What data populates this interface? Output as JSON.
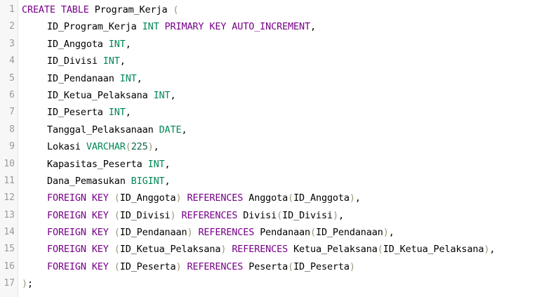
{
  "editor": {
    "lines": [
      {
        "number": "1",
        "tokens": [
          {
            "t": "CREATE TABLE",
            "c": "kw"
          },
          {
            "t": " Program_Kerja ",
            "c": "id"
          },
          {
            "t": "(",
            "c": "pun"
          }
        ],
        "indent": false
      },
      {
        "number": "2",
        "tokens": [
          {
            "t": "ID_Program_Kerja ",
            "c": "id"
          },
          {
            "t": "INT",
            "c": "ty"
          },
          {
            "t": " ",
            "c": "id"
          },
          {
            "t": "PRIMARY KEY",
            "c": "kw"
          },
          {
            "t": " ",
            "c": "id"
          },
          {
            "t": "AUTO_INCREMENT",
            "c": "kw"
          },
          {
            "t": ",",
            "c": "id"
          }
        ],
        "indent": true
      },
      {
        "number": "3",
        "tokens": [
          {
            "t": "ID_Anggota ",
            "c": "id"
          },
          {
            "t": "INT",
            "c": "ty"
          },
          {
            "t": ",",
            "c": "id"
          }
        ],
        "indent": true
      },
      {
        "number": "4",
        "tokens": [
          {
            "t": "ID_Divisi ",
            "c": "id"
          },
          {
            "t": "INT",
            "c": "ty"
          },
          {
            "t": ",",
            "c": "id"
          }
        ],
        "indent": true
      },
      {
        "number": "5",
        "tokens": [
          {
            "t": "ID_Pendanaan ",
            "c": "id"
          },
          {
            "t": "INT",
            "c": "ty"
          },
          {
            "t": ",",
            "c": "id"
          }
        ],
        "indent": true
      },
      {
        "number": "6",
        "tokens": [
          {
            "t": "ID_Ketua_Pelaksana ",
            "c": "id"
          },
          {
            "t": "INT",
            "c": "ty"
          },
          {
            "t": ",",
            "c": "id"
          }
        ],
        "indent": true
      },
      {
        "number": "7",
        "tokens": [
          {
            "t": "ID_Peserta ",
            "c": "id"
          },
          {
            "t": "INT",
            "c": "ty"
          },
          {
            "t": ",",
            "c": "id"
          }
        ],
        "indent": true
      },
      {
        "number": "8",
        "tokens": [
          {
            "t": "Tanggal_Pelaksanaan ",
            "c": "id"
          },
          {
            "t": "DATE",
            "c": "ty"
          },
          {
            "t": ",",
            "c": "id"
          }
        ],
        "indent": true
      },
      {
        "number": "9",
        "tokens": [
          {
            "t": "Lokasi ",
            "c": "id"
          },
          {
            "t": "VARCHAR",
            "c": "ty"
          },
          {
            "t": "(",
            "c": "pun"
          },
          {
            "t": "225",
            "c": "num"
          },
          {
            "t": ")",
            "c": "pun"
          },
          {
            "t": ",",
            "c": "id"
          }
        ],
        "indent": true
      },
      {
        "number": "10",
        "tokens": [
          {
            "t": "Kapasitas_Peserta ",
            "c": "id"
          },
          {
            "t": "INT",
            "c": "ty"
          },
          {
            "t": ",",
            "c": "id"
          }
        ],
        "indent": true
      },
      {
        "number": "11",
        "tokens": [
          {
            "t": "Dana_Pemasukan ",
            "c": "id"
          },
          {
            "t": "BIGINT",
            "c": "ty"
          },
          {
            "t": ",",
            "c": "id"
          }
        ],
        "indent": true
      },
      {
        "number": "12",
        "tokens": [
          {
            "t": "FOREIGN KEY",
            "c": "kw"
          },
          {
            "t": " ",
            "c": "id"
          },
          {
            "t": "(",
            "c": "pun"
          },
          {
            "t": "ID_Anggota",
            "c": "id"
          },
          {
            "t": ")",
            "c": "pun"
          },
          {
            "t": " ",
            "c": "id"
          },
          {
            "t": "REFERENCES",
            "c": "kw"
          },
          {
            "t": " Anggota",
            "c": "id"
          },
          {
            "t": "(",
            "c": "pun"
          },
          {
            "t": "ID_Anggota",
            "c": "id"
          },
          {
            "t": ")",
            "c": "pun"
          },
          {
            "t": ",",
            "c": "id"
          }
        ],
        "indent": true
      },
      {
        "number": "13",
        "tokens": [
          {
            "t": "FOREIGN KEY",
            "c": "kw"
          },
          {
            "t": " ",
            "c": "id"
          },
          {
            "t": "(",
            "c": "pun"
          },
          {
            "t": "ID_Divisi",
            "c": "id"
          },
          {
            "t": ")",
            "c": "pun"
          },
          {
            "t": " ",
            "c": "id"
          },
          {
            "t": "REFERENCES",
            "c": "kw"
          },
          {
            "t": " Divisi",
            "c": "id"
          },
          {
            "t": "(",
            "c": "pun"
          },
          {
            "t": "ID_Divisi",
            "c": "id"
          },
          {
            "t": ")",
            "c": "pun"
          },
          {
            "t": ",",
            "c": "id"
          }
        ],
        "indent": true
      },
      {
        "number": "14",
        "tokens": [
          {
            "t": "FOREIGN KEY",
            "c": "kw"
          },
          {
            "t": " ",
            "c": "id"
          },
          {
            "t": "(",
            "c": "pun"
          },
          {
            "t": "ID_Pendanaan",
            "c": "id"
          },
          {
            "t": ")",
            "c": "pun"
          },
          {
            "t": " ",
            "c": "id"
          },
          {
            "t": "REFERENCES",
            "c": "kw"
          },
          {
            "t": " Pendanaan",
            "c": "id"
          },
          {
            "t": "(",
            "c": "pun"
          },
          {
            "t": "ID_Pendanaan",
            "c": "id"
          },
          {
            "t": ")",
            "c": "pun"
          },
          {
            "t": ",",
            "c": "id"
          }
        ],
        "indent": true
      },
      {
        "number": "15",
        "tokens": [
          {
            "t": "FOREIGN KEY",
            "c": "kw"
          },
          {
            "t": " ",
            "c": "id"
          },
          {
            "t": "(",
            "c": "pun"
          },
          {
            "t": "ID_Ketua_Pelaksana",
            "c": "id"
          },
          {
            "t": ")",
            "c": "pun"
          },
          {
            "t": " ",
            "c": "id"
          },
          {
            "t": "REFERENCES",
            "c": "kw"
          },
          {
            "t": " Ketua_Pelaksana",
            "c": "id"
          },
          {
            "t": "(",
            "c": "pun"
          },
          {
            "t": "ID_Ketua_Pelaksana",
            "c": "id"
          },
          {
            "t": ")",
            "c": "pun"
          },
          {
            "t": ",",
            "c": "id"
          }
        ],
        "indent": true
      },
      {
        "number": "16",
        "tokens": [
          {
            "t": "FOREIGN KEY",
            "c": "kw"
          },
          {
            "t": " ",
            "c": "id"
          },
          {
            "t": "(",
            "c": "pun"
          },
          {
            "t": "ID_Peserta",
            "c": "id"
          },
          {
            "t": ")",
            "c": "pun"
          },
          {
            "t": " ",
            "c": "id"
          },
          {
            "t": "REFERENCES",
            "c": "kw"
          },
          {
            "t": " Peserta",
            "c": "id"
          },
          {
            "t": "(",
            "c": "pun"
          },
          {
            "t": "ID_Peserta",
            "c": "id"
          },
          {
            "t": ")",
            "c": "pun"
          }
        ],
        "indent": true
      },
      {
        "number": "17",
        "tokens": [
          {
            "t": ")",
            "c": "pun"
          },
          {
            "t": ";",
            "c": "id"
          }
        ],
        "indent": false
      }
    ]
  },
  "colors": {
    "keyword": "#770088",
    "type": "#008855",
    "number": "#116644",
    "bracket": "#999977",
    "identifier": "#000000",
    "line_number": "#999999",
    "gutter_bg": "#f7f7f7"
  }
}
